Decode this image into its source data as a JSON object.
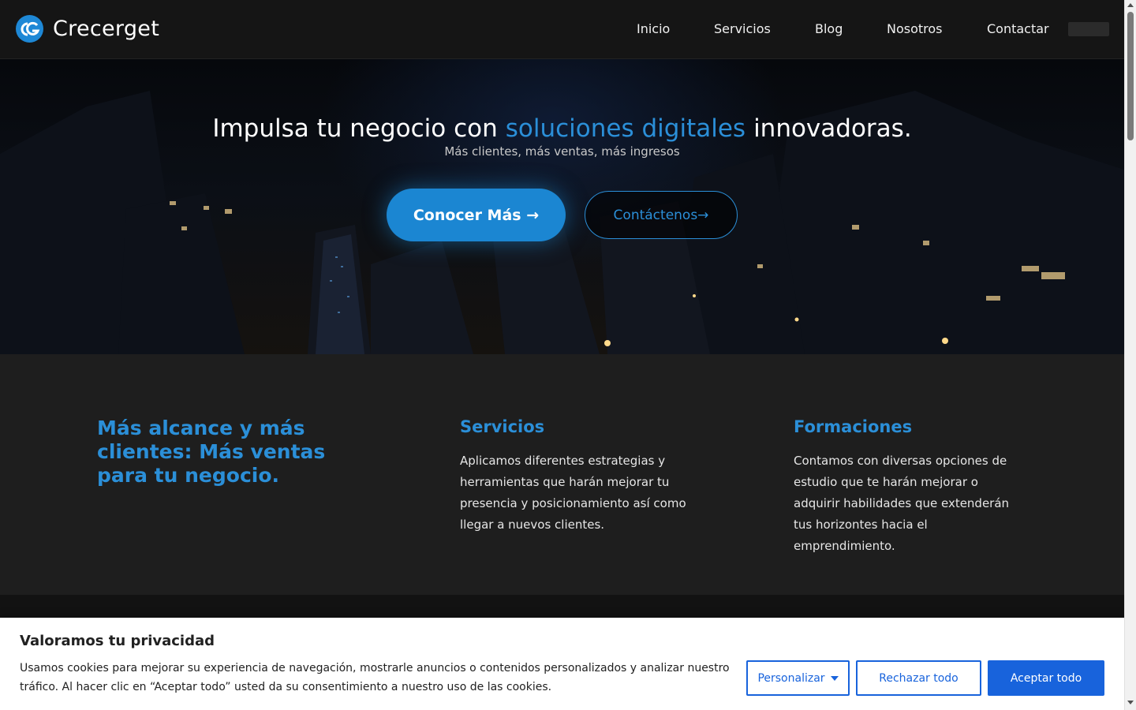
{
  "header": {
    "brand": "Crecerget",
    "nav": [
      "Inicio",
      "Servicios",
      "Blog",
      "Nosotros",
      "Contactar"
    ]
  },
  "hero": {
    "title_before": "Impulsa tu negocio con",
    "title_highlight": "soluciones digitales",
    "title_after": "innovadoras.",
    "subtitle": "Más clientes, más ventas, más ingresos",
    "primary_button": "Conocer Más →",
    "secondary_button": "Contáctenos→"
  },
  "features": {
    "headline": "Más alcance y más clientes: Más ventas para tu negocio.",
    "columns": [
      {
        "title": "Servicios",
        "text": "Aplicamos diferentes estrategias y herramientas que harán mejorar tu presencia y posicionamiento así como llegar a nuevos clientes."
      },
      {
        "title": "Formaciones",
        "text": "Contamos con diversas opciones de estudio que te harán mejorar o adquirir habilidades que extenderán tus horizontes hacia el emprendimiento."
      }
    ]
  },
  "cookie_banner": {
    "title": "Valoramos tu privacidad",
    "text": "Usamos cookies para mejorar su experiencia de navegación, mostrarle anuncios o contenidos personalizados y analizar nuestro tráfico. Al hacer clic en “Aceptar todo” usted da su consentimiento a nuestro uso de las cookies.",
    "customize": "Personalizar",
    "reject": "Rechazar todo",
    "accept": "Aceptar todo"
  },
  "colors": {
    "accent": "#2b8fd8",
    "primary_button": "#1b86d2",
    "cookie_button": "#1863dc"
  }
}
